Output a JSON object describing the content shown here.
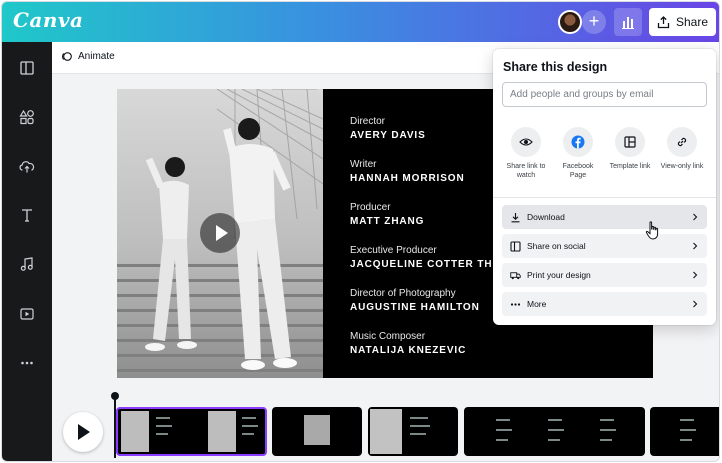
{
  "app": {
    "logo": "Canva",
    "brand_colors": {
      "gradient_start": "#1fc8c9",
      "gradient_end": "#6a45e6",
      "accent": "#8b3dff"
    }
  },
  "header": {
    "share_label": "Share",
    "icons": [
      "user-avatar",
      "plus-icon",
      "bar-chart-icon",
      "share-upload-icon"
    ]
  },
  "sidebar": {
    "items": [
      {
        "icon": "layout-icon"
      },
      {
        "icon": "elements-icon"
      },
      {
        "icon": "upload-cloud-icon"
      },
      {
        "icon": "text-icon"
      },
      {
        "icon": "music-icon"
      },
      {
        "icon": "video-icon"
      },
      {
        "icon": "more-icon"
      }
    ]
  },
  "toolbar": {
    "animate_label": "Animate"
  },
  "design": {
    "credits": [
      {
        "role": "Director",
        "name": "AVERY DAVIS"
      },
      {
        "role": "Writer",
        "name": "HANNAH MORRISON"
      },
      {
        "role": "Producer",
        "name": "MATT ZHANG"
      },
      {
        "role": "Executive Producer",
        "name": "JACQUELINE COTTER THOM"
      },
      {
        "role": "Director of Photography",
        "name": "AUGUSTINE HAMILTON"
      },
      {
        "role": "Music Composer",
        "name": "NATALIJA KNEZEVIC"
      }
    ]
  },
  "share_panel": {
    "title": "Share this design",
    "input_placeholder": "Add people and groups by email",
    "share_options": [
      {
        "label": "Share link to watch",
        "icon": "eye-icon"
      },
      {
        "label": "Facebook Page",
        "icon": "facebook-icon"
      },
      {
        "label": "Template link",
        "icon": "template-icon"
      },
      {
        "label": "View-only link",
        "icon": "link-icon"
      }
    ],
    "actions": [
      {
        "label": "Download",
        "icon": "download-icon",
        "hovered": true
      },
      {
        "label": "Share on social",
        "icon": "social-icon"
      },
      {
        "label": "Print your design",
        "icon": "truck-icon"
      },
      {
        "label": "More",
        "icon": "more-dots-icon"
      }
    ]
  }
}
